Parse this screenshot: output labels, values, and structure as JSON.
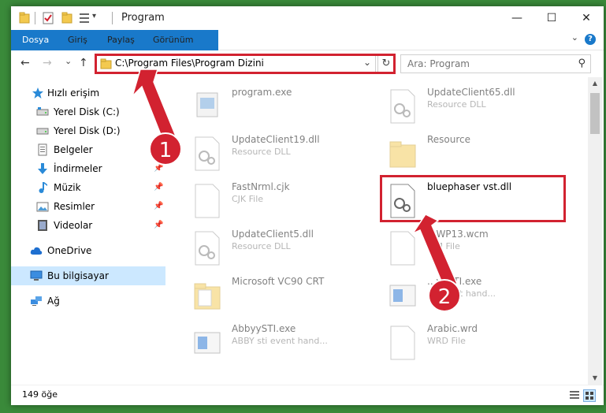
{
  "window": {
    "title": "Program",
    "controls": {
      "minimize": "—",
      "maximize": "☐",
      "close": "✕"
    }
  },
  "ribbon": {
    "tabs": [
      "Dosya",
      "Giriş",
      "Paylaş",
      "Görünüm"
    ],
    "help": "?"
  },
  "nav": {
    "back": "←",
    "forward": "→",
    "recent": "⌄",
    "up": "↑",
    "address": "C:\\Program Files\\Program Dizini",
    "address_dropdown": "⌄",
    "refresh": "↻",
    "search_placeholder": "Ara: Program"
  },
  "sidebar": {
    "items": [
      {
        "label": "Hızlı erişim",
        "icon": "star-icon"
      },
      {
        "label": "Yerel Disk (C:)",
        "icon": "drive-icon",
        "pinned": true
      },
      {
        "label": "Yerel Disk (D:)",
        "icon": "drive-icon"
      },
      {
        "label": "Belgeler",
        "icon": "documents-icon"
      },
      {
        "label": "İndirmeler",
        "icon": "download-icon",
        "pinned": true
      },
      {
        "label": "Müzik",
        "icon": "music-icon",
        "pinned": true
      },
      {
        "label": "Resimler",
        "icon": "pictures-icon",
        "pinned": true
      },
      {
        "label": "Videolar",
        "icon": "videos-icon",
        "pinned": true
      },
      {
        "label": "OneDrive",
        "icon": "cloud-icon"
      },
      {
        "label": "Bu bilgisayar",
        "icon": "computer-icon",
        "selected": true
      },
      {
        "label": "Ağ",
        "icon": "network-icon"
      }
    ]
  },
  "files": [
    {
      "name": "program.exe",
      "type": "",
      "icon": "exe-icon"
    },
    {
      "name": "UpdateClient65.dll",
      "type": "Resource DLL",
      "icon": "dll-icon"
    },
    {
      "name": "UpdateClient19.dll",
      "type": "Resource DLL",
      "icon": "dll-icon"
    },
    {
      "name": "Resource",
      "type": "",
      "icon": "folder-icon"
    },
    {
      "name": "FastNrml.cjk",
      "type": "CJK File",
      "icon": "file-icon"
    },
    {
      "name": "bluephaser vst.dll",
      "type": "",
      "icon": "dll-icon"
    },
    {
      "name": "UpdateClient5.dll",
      "type": "Resource DLL",
      "icon": "dll-icon"
    },
    {
      "name": "...WP13.wcm",
      "type": "...M File",
      "icon": "file-icon"
    },
    {
      "name": "Microsoft VC90 CRT",
      "type": "",
      "icon": "folder-icon"
    },
    {
      "name": "...yySTI.exe",
      "type": "... event hand...",
      "icon": "app-icon"
    },
    {
      "name": "AbbyySTI.exe",
      "type": "ABBY sti event hand...",
      "icon": "app-icon"
    },
    {
      "name": "Arabic.wrd",
      "type": "WRD File",
      "icon": "file-icon"
    }
  ],
  "status": {
    "count": "149 öğe"
  },
  "annotations": [
    "1",
    "2"
  ],
  "colors": {
    "accent": "#1979ca",
    "highlight": "#d22230",
    "selected": "#cce8ff",
    "folder": "#f3c94f"
  }
}
